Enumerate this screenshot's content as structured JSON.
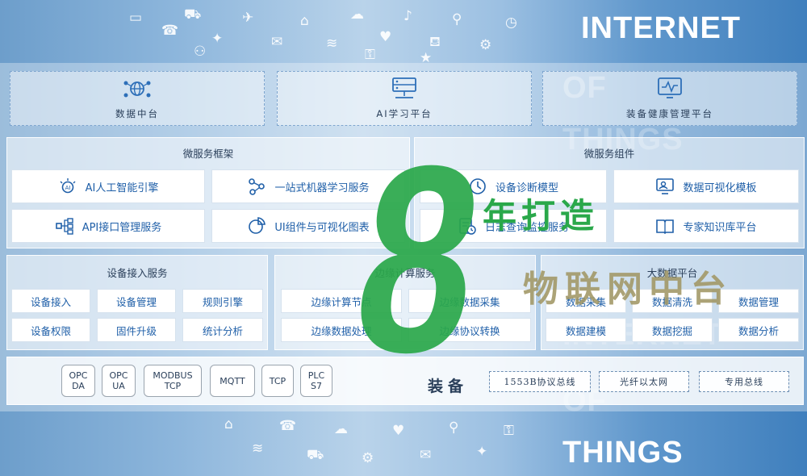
{
  "watermark_words": {
    "internet": "INTERNET",
    "of": "OF",
    "things": "THINGS"
  },
  "top_cards": [
    {
      "label": "数据中台",
      "icon": "globe-network-icon"
    },
    {
      "label": "AI学习平台",
      "icon": "server-icon"
    },
    {
      "label": "装备健康管理平台",
      "icon": "monitor-pulse-icon"
    }
  ],
  "microservice_framework": {
    "title": "微服务框架",
    "items": [
      {
        "label": "AI人工智能引擎",
        "icon": "ai-bulb-icon"
      },
      {
        "label": "一站式机器学习服务",
        "icon": "nodes-icon"
      },
      {
        "label": "API接口管理服务",
        "icon": "api-tree-icon"
      },
      {
        "label": "UI组件与可视化图表",
        "icon": "pie-chart-icon"
      }
    ]
  },
  "microservice_components": {
    "title": "微服务组件",
    "items": [
      {
        "label": "设备诊断模型",
        "icon": "diagnosis-icon"
      },
      {
        "label": "数据可视化模板",
        "icon": "monitor-user-icon"
      },
      {
        "label": "日志查询监控服务",
        "icon": "log-clock-icon"
      },
      {
        "label": "专家知识库平台",
        "icon": "book-icon"
      }
    ]
  },
  "device_access": {
    "title": "设备接入服务",
    "items": [
      "设备接入",
      "设备管理",
      "规则引擎",
      "设备权限",
      "固件升级",
      "统计分析"
    ]
  },
  "edge_computing": {
    "title": "边缘计算服务",
    "items": [
      "边缘计算节点",
      "边缘数据采集",
      "边缘数据处理",
      "边缘协议转换"
    ]
  },
  "big_data": {
    "title": "大数据平台",
    "items": [
      "数据采集",
      "数据清洗",
      "数据管理",
      "数据建模",
      "数据挖掘",
      "数据分析"
    ]
  },
  "protocols": [
    {
      "line1": "OPC",
      "line2": "DA"
    },
    {
      "line1": "OPC",
      "line2": "UA"
    },
    {
      "line1": "MODBUS",
      "line2": "TCP"
    },
    {
      "line1": "MQTT",
      "line2": ""
    },
    {
      "line1": "TCP",
      "line2": ""
    },
    {
      "line1": "PLC",
      "line2": "S7"
    }
  ],
  "equipment_label": "装备",
  "buses": [
    "1553B协议总线",
    "光纤以太网",
    "专用总线"
  ],
  "overlay": {
    "number": "8",
    "line1": "年打造",
    "line2": "物联网中台"
  },
  "colors": {
    "accent_green": "#2aa84a",
    "tile_text_blue": "#1f5fa8"
  }
}
